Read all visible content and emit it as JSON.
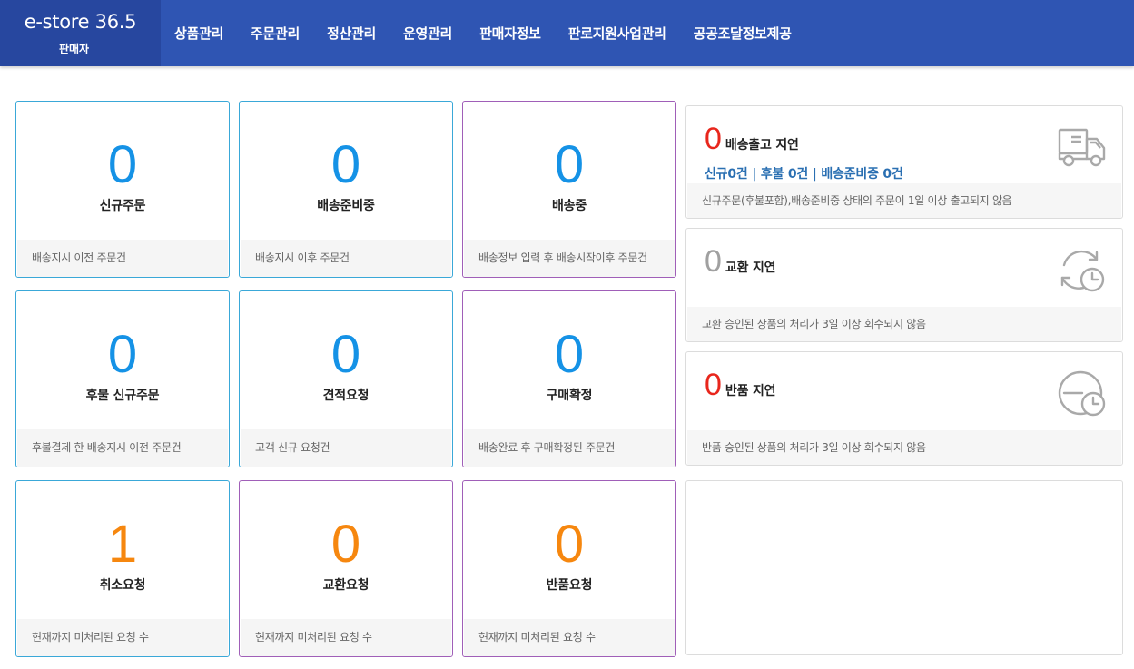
{
  "brand": {
    "name": "e-store 36.5",
    "sub": "판매자"
  },
  "nav": [
    "상품관리",
    "주문관리",
    "정산관리",
    "운영관리",
    "판매자정보",
    "판로지원사업관리",
    "공공조달정보제공"
  ],
  "cards": [
    {
      "count": "0",
      "label": "신규주문",
      "desc": "배송지시 이전 주문건"
    },
    {
      "count": "0",
      "label": "배송준비중",
      "desc": "배송지시 이후 주문건"
    },
    {
      "count": "0",
      "label": "배송중",
      "desc": "배송정보 입력 후 배송시작이후 주문건"
    },
    {
      "count": "0",
      "label": "후불 신규주문",
      "desc": "후불결제 한 배송지시 이전 주문건"
    },
    {
      "count": "0",
      "label": "견적요청",
      "desc": "고객 신규 요청건"
    },
    {
      "count": "0",
      "label": "구매확정",
      "desc": "배송완료 후 구매확정된 주문건"
    },
    {
      "count": "1",
      "label": "취소요청",
      "desc": "현재까지 미처리된 요청 수"
    },
    {
      "count": "0",
      "label": "교환요청",
      "desc": "현재까지 미처리된 요청 수"
    },
    {
      "count": "0",
      "label": "반품요청",
      "desc": "현재까지 미처리된 요청 수"
    }
  ],
  "delays": [
    {
      "count": "0",
      "title": "배송출고 지연",
      "sub": "신규0건 | 후불 0건 | 배송준비중 0건",
      "desc": "신규주문(후불포함),배송준비중 상태의 주문이 1일 이상 출고되지 않음",
      "icon": "truck-icon"
    },
    {
      "count": "0",
      "title": "교환 지연",
      "desc": "교환 승인된 상품의 처리가 3일 이상 회수되지 않음",
      "icon": "exchange-clock-icon"
    },
    {
      "count": "0",
      "title": "반품 지연",
      "desc": "반품 승인된 상품의 처리가 3일 이상 회수되지 않음",
      "icon": "return-clock-icon"
    }
  ],
  "colors": {
    "header": "#2f55b3",
    "brand_bg": "#27479f",
    "count_blue": "#1592e6",
    "count_orange": "#f6870f",
    "delay_red": "#e8261c",
    "delay_grey": "#a0a0a0",
    "sub_blue": "#2a6fb2",
    "border_blue": "#3aa8d8",
    "border_purple": "#a05fb8"
  }
}
